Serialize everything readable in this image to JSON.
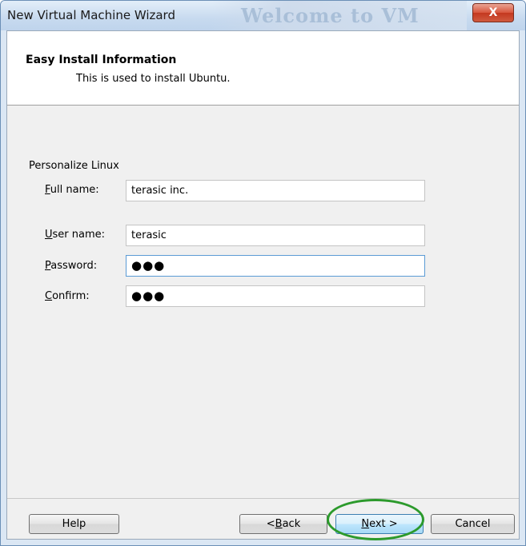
{
  "window": {
    "title": "New Virtual Machine Wizard",
    "background_title": "Welcome to VM",
    "close_glyph": "X"
  },
  "header": {
    "title": "Easy Install Information",
    "subtitle": "This is used to install Ubuntu."
  },
  "form": {
    "group_label": "Personalize Linux",
    "full_name": {
      "label_mnemonic": "F",
      "label_rest": "ull name:",
      "value": "terasic inc."
    },
    "user_name": {
      "label_mnemonic": "U",
      "label_rest": "ser name:",
      "value": "terasic"
    },
    "password": {
      "label_mnemonic": "P",
      "label_rest": "assword:",
      "value": "●●●"
    },
    "confirm": {
      "label_mnemonic": "C",
      "label_rest": "onfirm:",
      "value": "●●●"
    }
  },
  "buttons": {
    "help": "Help",
    "back_prefix": "< ",
    "back_mnemonic": "B",
    "back_rest": "ack",
    "next_mnemonic": "N",
    "next_rest": "ext >",
    "cancel": "Cancel"
  },
  "colors": {
    "highlight_ring": "#2c9a2c",
    "close_button": "#c4381f",
    "focus_border": "#5b9bd5"
  }
}
